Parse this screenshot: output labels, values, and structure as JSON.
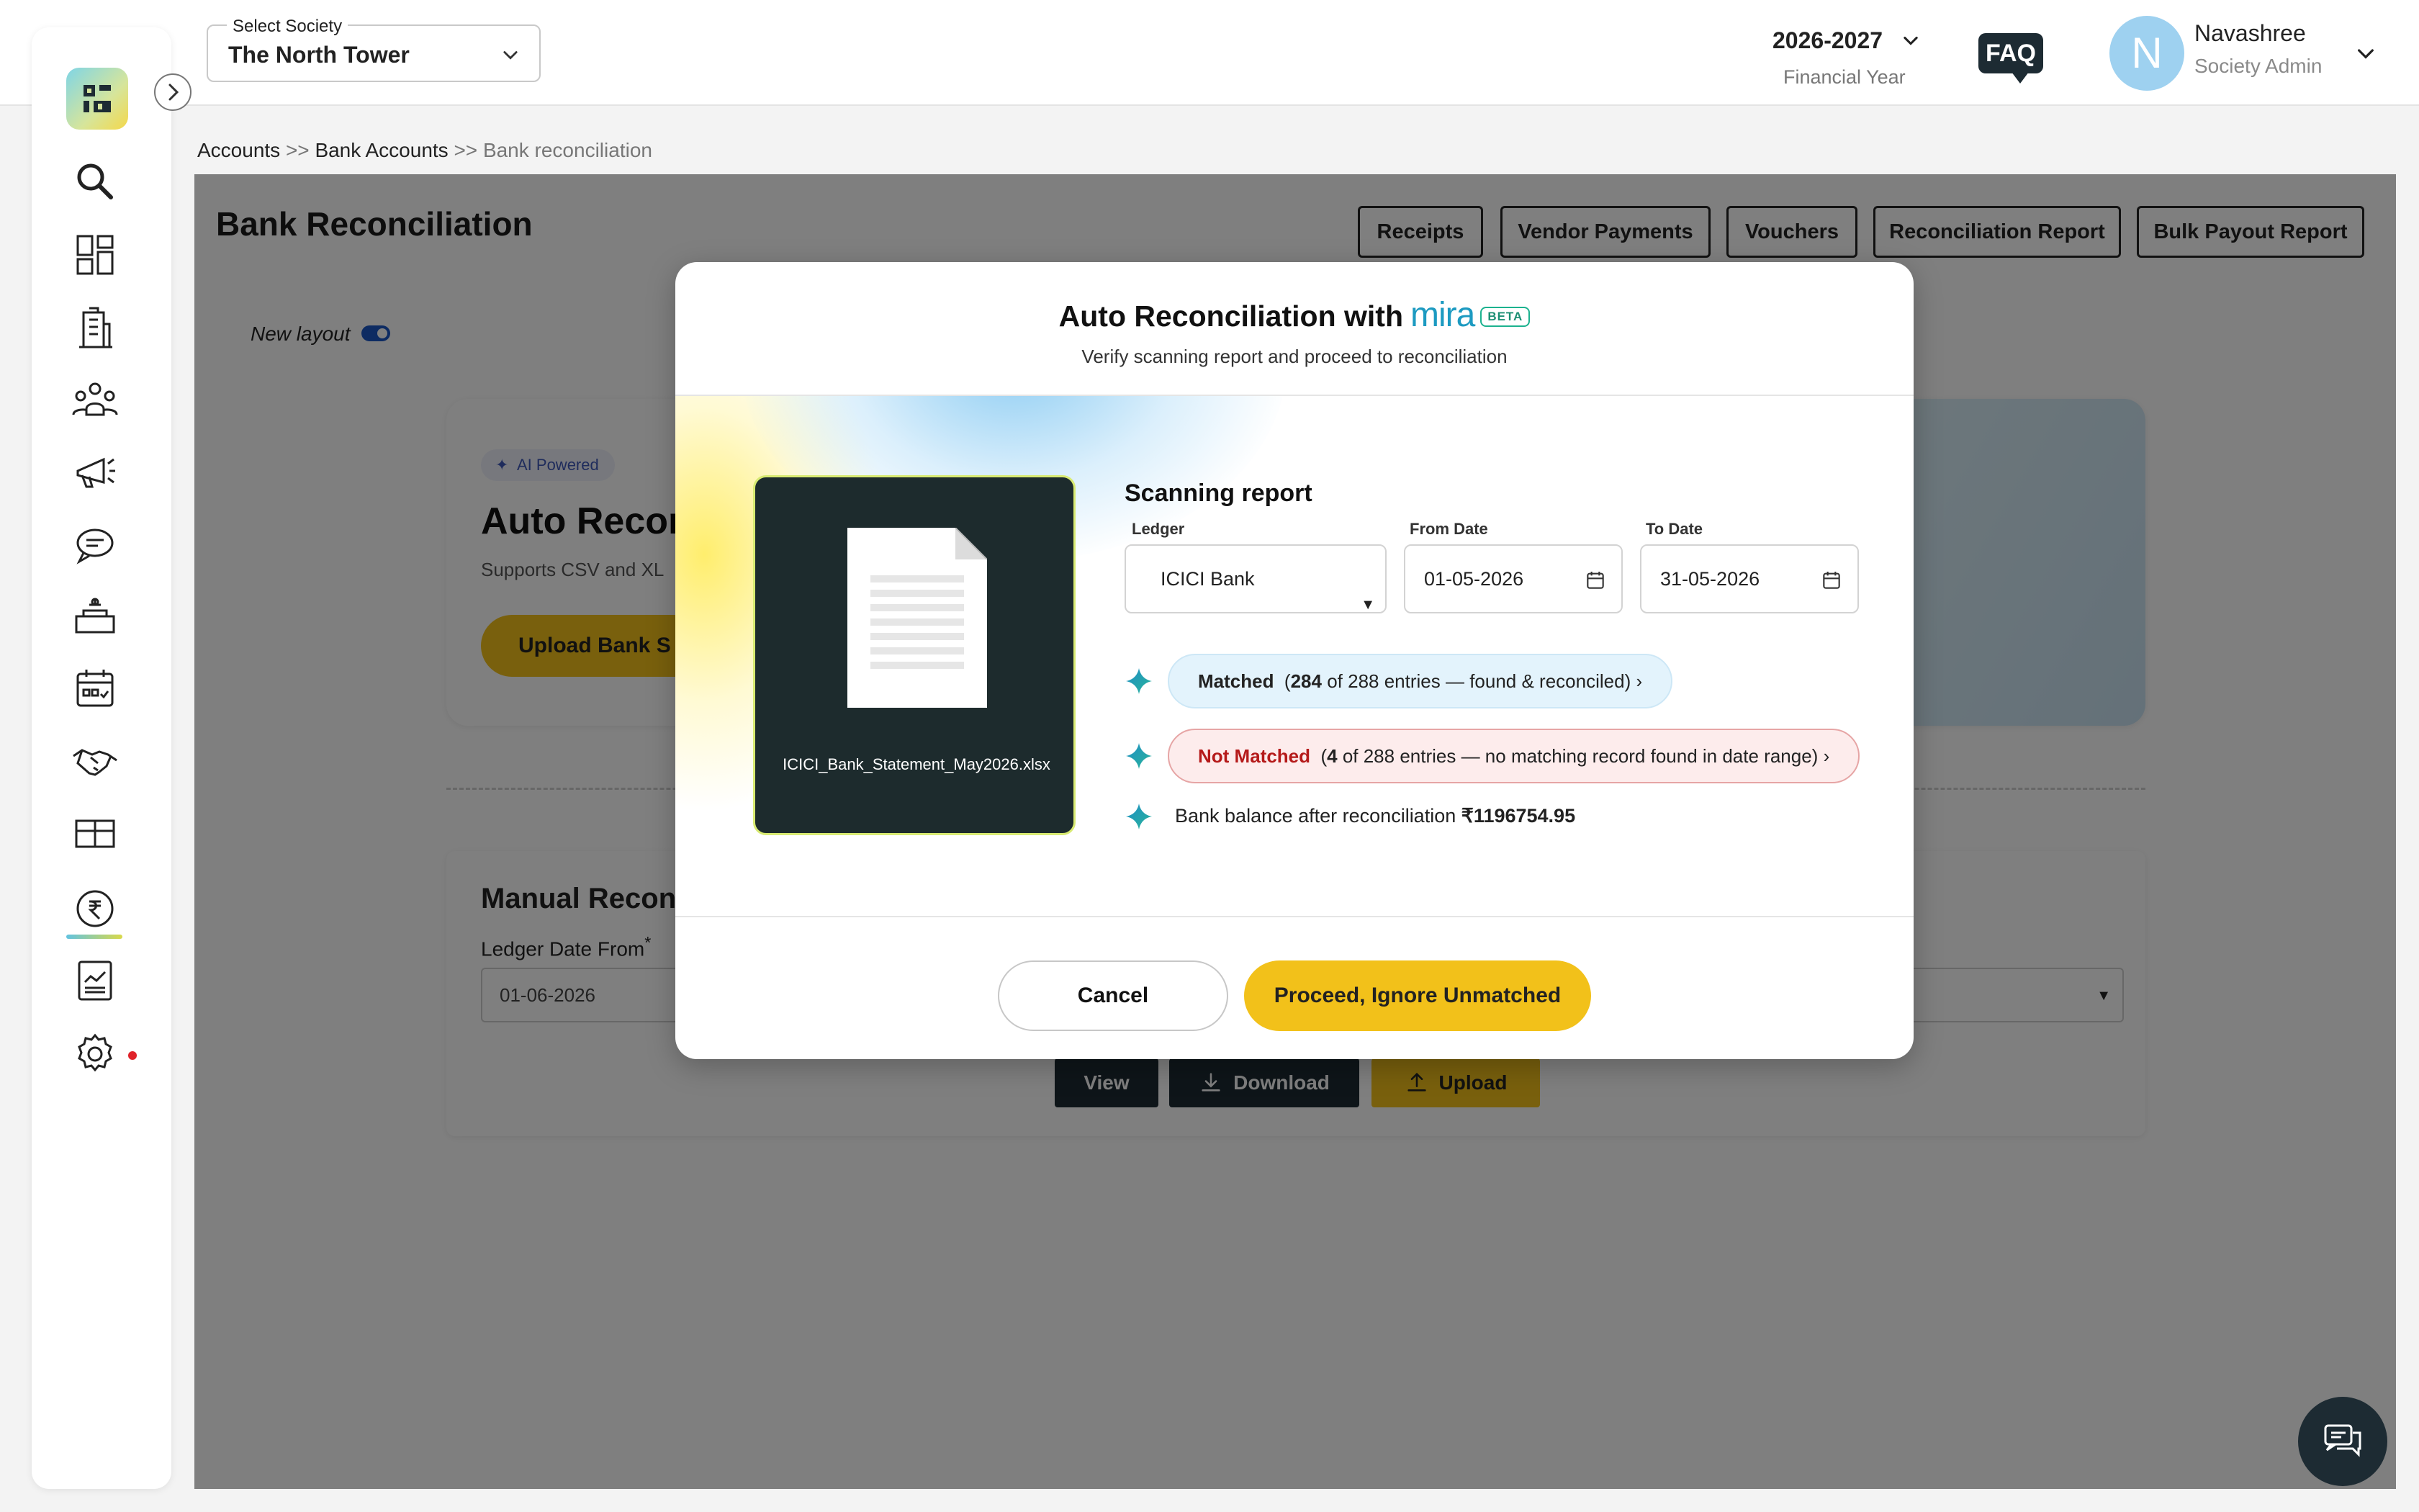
{
  "header": {
    "society_label": "Select Society",
    "society_value": "The North Tower",
    "financial_year": "2026-2027",
    "financial_year_label": "Financial Year",
    "faq_label": "FAQ",
    "user_initial": "N",
    "user_name": "Navashree",
    "user_role": "Society Admin"
  },
  "sidebar": {
    "items": [
      "search",
      "dashboard",
      "building",
      "members",
      "announcements",
      "messages",
      "facilities",
      "calendar",
      "vendors",
      "inventory",
      "accounts",
      "reports",
      "settings"
    ]
  },
  "breadcrumb": {
    "items": [
      "Accounts",
      "Bank Accounts"
    ],
    "current": "Bank reconciliation",
    "separator": ">>"
  },
  "page": {
    "title": "Bank Reconciliation",
    "tabs": [
      "Receipts",
      "Vendor Payments",
      "Vouchers",
      "Reconciliation Report",
      "Bulk Payout Report"
    ],
    "new_layout_label": "New layout",
    "ai_badge": "AI Powered",
    "auto_title": "Auto Recon",
    "auto_sub": "Supports CSV and XL",
    "upload_bank_label": "Upload Bank S",
    "manual_title": "Manual Reconci",
    "ledger_date_from_label": "Ledger Date From",
    "ledger_date_from_value": "01-06-2026",
    "view_label": "View",
    "download_label": "Download",
    "upload_label": "Upload"
  },
  "modal": {
    "title": "Auto Reconciliation with",
    "brand": "mira",
    "badge": "BETA",
    "subtitle": "Verify scanning report and proceed to reconciliation",
    "file_name": "ICICI_Bank_Statement_May2026.xlsx",
    "scan_title": "Scanning report",
    "ledger_label": "Ledger",
    "ledger_value": "ICICI Bank",
    "from_label": "From Date",
    "from_value": "01-05-2026",
    "to_label": "To Date",
    "to_value": "31-05-2026",
    "matched_label": "Matched",
    "matched_count": "284",
    "matched_detail": "of 288 entries — found & reconciled)",
    "not_matched_label": "Not Matched",
    "not_matched_count": "4",
    "not_matched_detail": "of 288 entries — no matching record found in date range)",
    "balance_label": "Bank balance after reconciliation",
    "balance_value": "₹1196754.95",
    "cancel_label": "Cancel",
    "proceed_label": "Proceed, Ignore Unmatched"
  },
  "colors": {
    "accent_yellow": "#f2c11a",
    "dark": "#1d2b33",
    "mira_blue": "#1c9ac1",
    "error_red": "#b51a1a"
  }
}
